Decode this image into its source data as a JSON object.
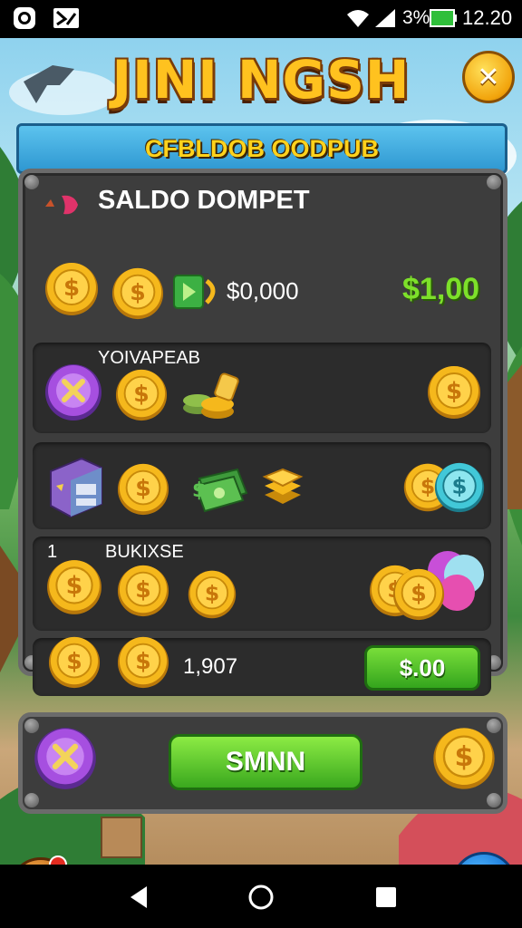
{
  "status_bar": {
    "battery_percent": "3%",
    "time": "12.20"
  },
  "game": {
    "title": "JINI NGSH",
    "banner": "CFBLDOB OODPUB",
    "close_label": "✕"
  },
  "wallet": {
    "heading": "SALDO DOMPET",
    "balance_text": "$0,000",
    "balance_green": "$1,00"
  },
  "rows": [
    {
      "label": "YOIVAPEAB"
    },
    {
      "label": ""
    },
    {
      "label": "BUKIXSE",
      "index": "1"
    },
    {
      "value": "1,907",
      "button": "$.00"
    }
  ],
  "actions": {
    "main_button": "SMNN",
    "cancel_symbol": "✕"
  },
  "colors": {
    "coin_gold": "#f5b81c",
    "accent_green": "#7de02a",
    "panel": "#3d3d3d",
    "banner_blue": "#2e97d1"
  }
}
